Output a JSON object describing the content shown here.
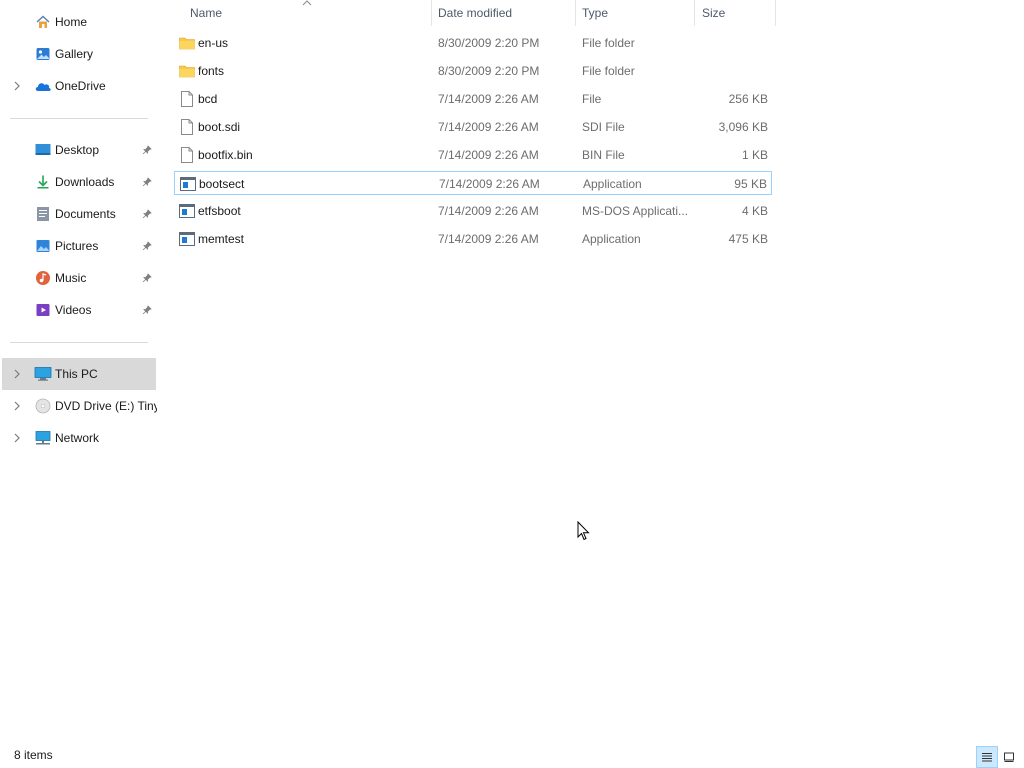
{
  "sidebar": {
    "quick": [
      {
        "label": "Home",
        "icon": "home-icon"
      },
      {
        "label": "Gallery",
        "icon": "gallery-icon"
      },
      {
        "label": "OneDrive",
        "icon": "onedrive-icon"
      }
    ],
    "pinned": [
      {
        "label": "Desktop",
        "icon": "desktop-icon"
      },
      {
        "label": "Downloads",
        "icon": "downloads-icon"
      },
      {
        "label": "Documents",
        "icon": "documents-icon"
      },
      {
        "label": "Pictures",
        "icon": "pictures-icon"
      },
      {
        "label": "Music",
        "icon": "music-icon"
      },
      {
        "label": "Videos",
        "icon": "videos-icon"
      }
    ],
    "locations": [
      {
        "label": "This PC",
        "icon": "this-pc-icon",
        "selected": true
      },
      {
        "label": "DVD Drive (E:) TinyXP",
        "icon": "dvd-drive-icon"
      },
      {
        "label": "Network",
        "icon": "network-icon"
      }
    ]
  },
  "columns": {
    "name": "Name",
    "date": "Date modified",
    "type": "Type",
    "size": "Size"
  },
  "files": [
    {
      "name": "en-us",
      "date": "8/30/2009 2:20 PM",
      "type": "File folder",
      "size": "",
      "icon": "folder-icon"
    },
    {
      "name": "fonts",
      "date": "8/30/2009 2:20 PM",
      "type": "File folder",
      "size": "",
      "icon": "folder-icon"
    },
    {
      "name": "bcd",
      "date": "7/14/2009 2:26 AM",
      "type": "File",
      "size": "256 KB",
      "icon": "file-icon"
    },
    {
      "name": "boot.sdi",
      "date": "7/14/2009 2:26 AM",
      "type": "SDI File",
      "size": "3,096 KB",
      "icon": "file-icon"
    },
    {
      "name": "bootfix.bin",
      "date": "7/14/2009 2:26 AM",
      "type": "BIN File",
      "size": "1 KB",
      "icon": "file-icon"
    },
    {
      "name": "bootsect",
      "date": "7/14/2009 2:26 AM",
      "type": "Application",
      "size": "95 KB",
      "icon": "application-icon",
      "selected": true
    },
    {
      "name": "etfsboot",
      "date": "7/14/2009 2:26 AM",
      "type": "MS-DOS Applicati...",
      "size": "4 KB",
      "icon": "application-icon"
    },
    {
      "name": "memtest",
      "date": "7/14/2009 2:26 AM",
      "type": "Application",
      "size": "475 KB",
      "icon": "application-icon"
    }
  ],
  "status": {
    "item_count": "8 items"
  },
  "colors": {
    "selection_border": "#99d1ff",
    "nav_selected": "#d9d9d9",
    "folder": "#f8c94a"
  }
}
